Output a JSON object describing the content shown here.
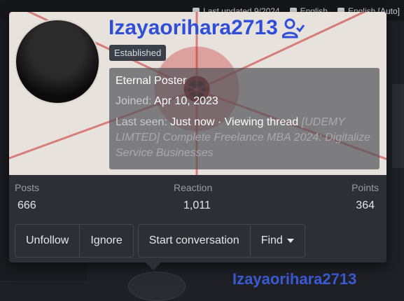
{
  "topbar": {
    "last_updated": "Last updated 9/2024",
    "language": "English",
    "caption": "English [Auto]"
  },
  "card": {
    "username": "Izayaorihara2713",
    "badge": "Established",
    "title": "Eternal Poster",
    "joined_label": "Joined:",
    "joined_value": "Apr 10, 2023",
    "last_seen_label": "Last seen:",
    "last_seen_value": "Just now",
    "activity": "· Viewing thread",
    "thread_title": "[UDEMY LIMTED] Complete Freelance MBA 2024: Digitalize Service Businesses"
  },
  "stats": {
    "posts_label": "Posts",
    "posts_value": "666",
    "reaction_label": "Reaction",
    "reaction_value": "1,011",
    "points_label": "Points",
    "points_value": "364"
  },
  "actions": {
    "unfollow": "Unfollow",
    "ignore": "Ignore",
    "start_conversation": "Start conversation",
    "find": "Find"
  },
  "background": {
    "username_preview": "Izayaorihara2713"
  },
  "colors": {
    "username": "#2f4ed8",
    "card_bg": "#2d2f36",
    "page_bg": "#1f2026"
  }
}
